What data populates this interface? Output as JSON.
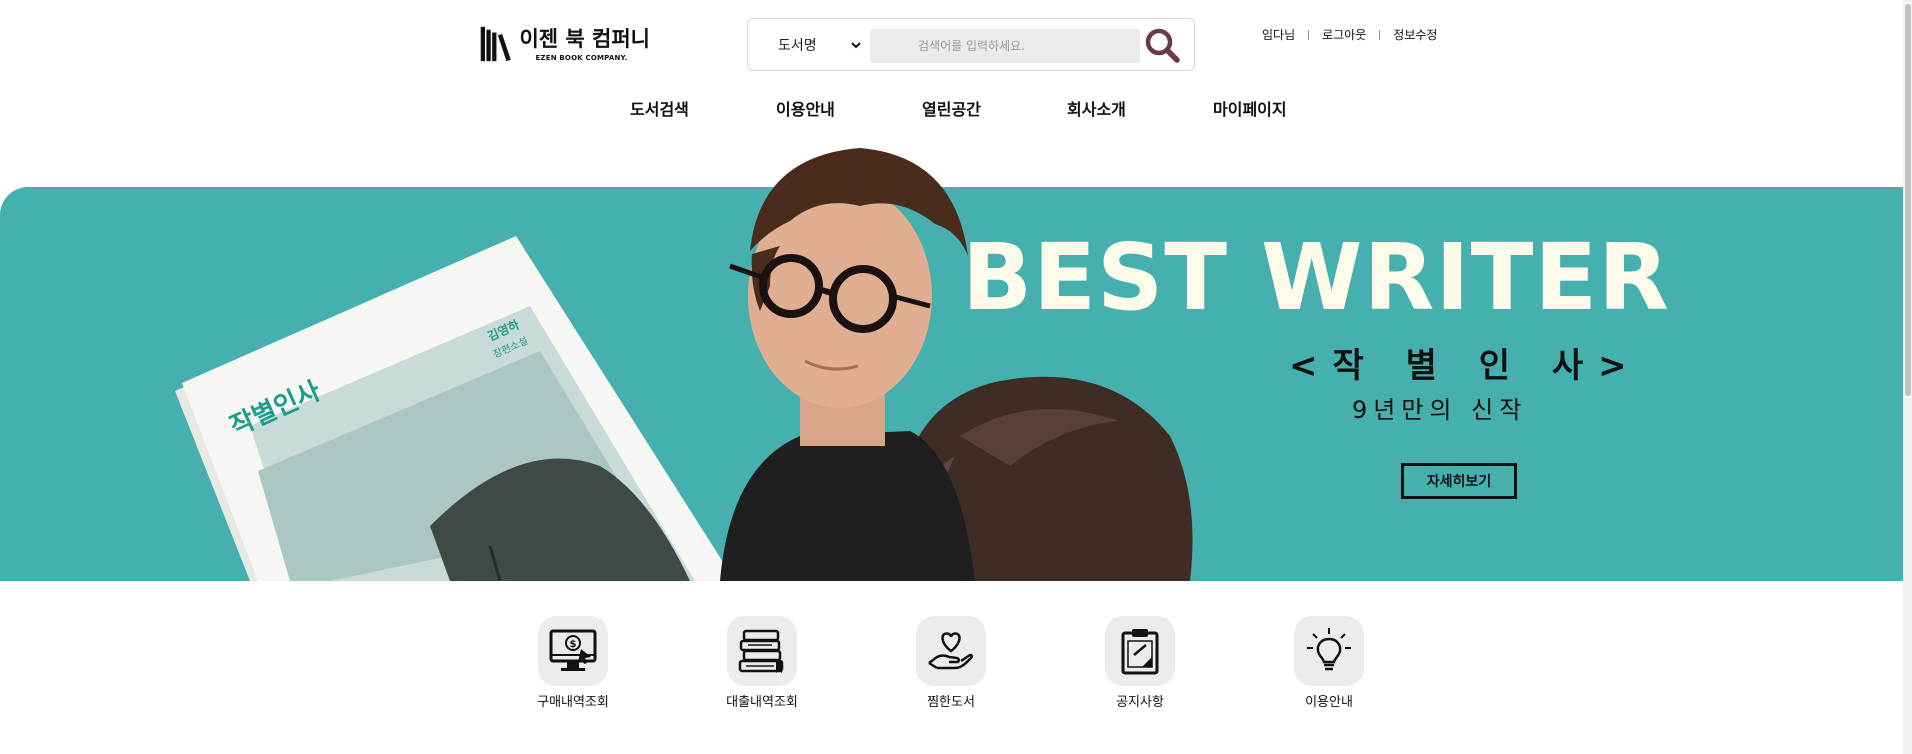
{
  "header": {
    "logo_title": "이젠 북 컴퍼니",
    "logo_sub": "EZEN BOOK COMPANY.",
    "search": {
      "category_selected": "도서명",
      "placeholder": "검색어를 입력하세요."
    },
    "util_links": {
      "user": "임다님",
      "logout": "로그아웃",
      "edit_profile": "정보수정"
    }
  },
  "nav": {
    "items": [
      "도서검색",
      "이용안내",
      "열린공간",
      "회사소개",
      "마이페이지"
    ]
  },
  "banner": {
    "title": "BEST WRITER",
    "subtitle": "<작 별 인 사>",
    "tagline": "9년만의 신작",
    "button_label": "자세히보기",
    "book_title": "작별인사",
    "book_author": "김영하",
    "book_kind": "장편소설",
    "background_color": "#45b0ae",
    "title_color": "#fffbea"
  },
  "quick_menu": {
    "items": [
      {
        "label": "구매내역조회",
        "icon": "monitor-dollar-icon"
      },
      {
        "label": "대출내역조회",
        "icon": "book-stack-icon"
      },
      {
        "label": "찜한도서",
        "icon": "heart-hand-icon"
      },
      {
        "label": "공지사항",
        "icon": "clipboard-icon"
      },
      {
        "label": "이용안내",
        "icon": "lightbulb-icon"
      }
    ]
  }
}
